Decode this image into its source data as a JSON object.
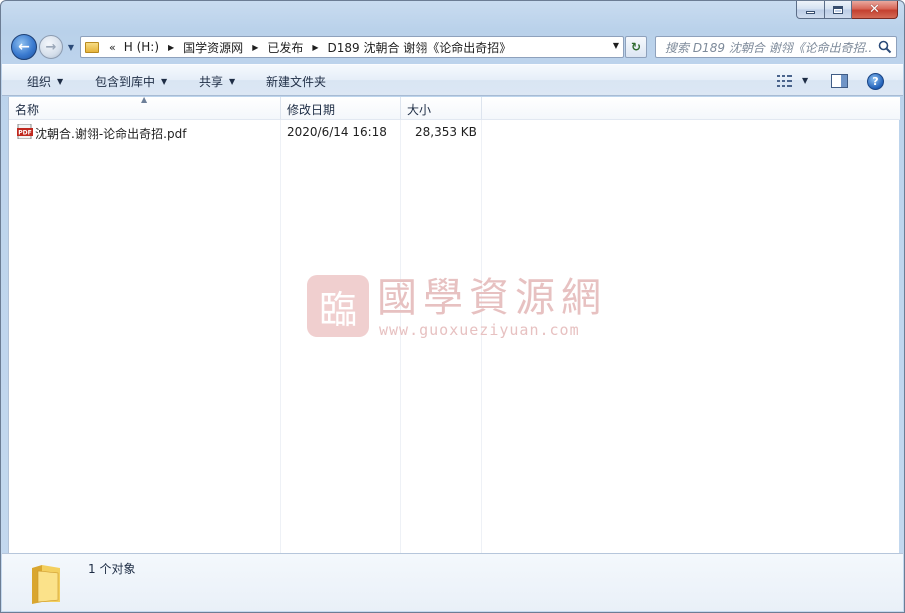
{
  "window": {
    "caption": {
      "close_glyph": "✕"
    }
  },
  "nav": {
    "back_glyph": "←",
    "forward_glyph": "→",
    "recent_glyph": "▼"
  },
  "address": {
    "overflow": "«",
    "crumbs": [
      "H (H:)",
      "国学资源网",
      "已发布",
      "D189 沈朝合 谢翎《论命出奇招》"
    ],
    "dropdown_glyph": "▼"
  },
  "refresh_glyph": "↻",
  "search": {
    "placeholder": "搜索 D189 沈朝合 谢翎《论命出奇招..."
  },
  "toolbar": {
    "organize": "组织",
    "include_library": "包含到库中",
    "share": "共享",
    "new_folder": "新建文件夹",
    "help": "?"
  },
  "columns": {
    "name": "名称",
    "modified": "修改日期",
    "size": "大小"
  },
  "files": [
    {
      "name": "沈朝合.谢翎-论命出奇招.pdf",
      "modified": "2020/6/14 16:18",
      "size": "28,353 KB",
      "icon": "pdf-file-icon"
    }
  ],
  "watermark": {
    "seal": "臨",
    "title": "國學資源網",
    "url": "www.guoxueziyuan.com"
  },
  "details": {
    "count": "1 个对象"
  },
  "colors": {
    "frame": "#b9d1ea",
    "close": "#c4402f",
    "watermark": "#e7c1c1"
  }
}
